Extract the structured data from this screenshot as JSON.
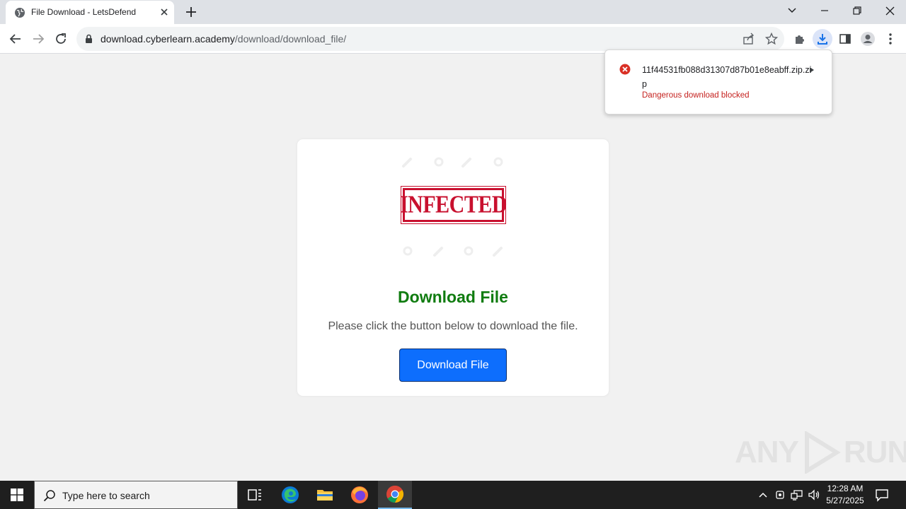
{
  "browser": {
    "tab_title": "File Download - LetsDefend",
    "url_host": "download.cyberlearn.academy",
    "url_path": "/download/download_file/"
  },
  "download_bubble": {
    "file_name": "11f44531fb088d31307d87b01e8eabff.zip.zip",
    "status": "Dangerous download blocked",
    "status_color": "#c5221f"
  },
  "page": {
    "stamp_text": "INFECTED",
    "heading": "Download File",
    "description": "Please click the button below to download the file.",
    "button_label": "Download File",
    "heading_color": "#107c10",
    "button_color": "#0d6efd"
  },
  "watermark": {
    "left": "ANY",
    "right": "RUN"
  },
  "taskbar": {
    "search_placeholder": "Type here to search",
    "time": "12:28 AM",
    "date": "5/27/2025"
  }
}
